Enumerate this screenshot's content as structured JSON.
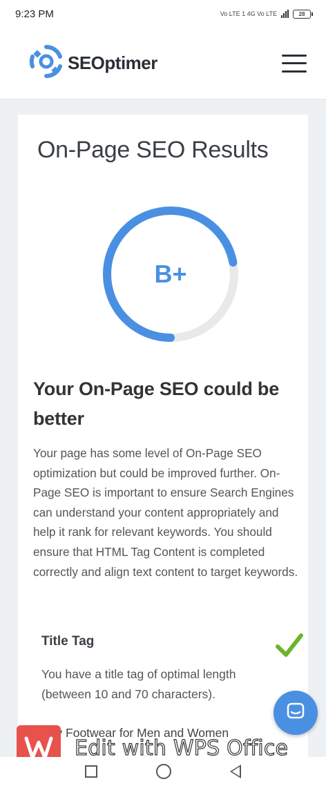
{
  "status_bar": {
    "time": "9:23 PM",
    "indicators": "Vo LTE 1 4G Vo LTE",
    "battery": "28"
  },
  "header": {
    "logo_text": "SEOptimer",
    "menu_icon": "hamburger-icon"
  },
  "results": {
    "title": "On-Page SEO Results",
    "grade": "B+",
    "score_fraction": 0.72,
    "headline": "Your On-Page SEO could be better",
    "description": "Your page has some level of On-Page SEO optimization but could be improved further. On-Page SEO is important to ensure Search Engines can understand your content appropriately and help it rank for relevant keywords. You should ensure that HTML Tag Content is completed correctly and align text content to target keywords."
  },
  "check": {
    "title": "Title Tag",
    "status_icon": "checkmark-icon",
    "description": "You have a title tag of optimal length (between 10 and 70 characters).",
    "value": "Buy Footwear for Men and Women"
  },
  "overlay": {
    "chat_icon": "chat-icon",
    "wps_text": "Edit with WPS Office",
    "wps_icon": "wps-logo-icon"
  },
  "nav": {
    "recent_icon": "square-icon",
    "home_icon": "circle-icon",
    "back_icon": "back-triangle-icon"
  },
  "colors": {
    "accent": "#4a90e2",
    "check_green": "#6bb52a",
    "wps_red": "#e7524d"
  }
}
